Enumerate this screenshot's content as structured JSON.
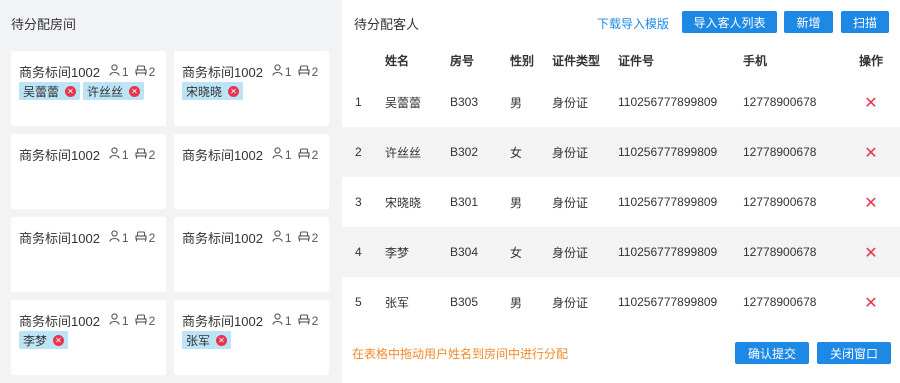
{
  "left": {
    "title": "待分配房间",
    "rooms": [
      {
        "name": "商务标间1002",
        "cap_a": "1",
        "cap_b": "2",
        "guests": [
          "吴蕾蕾",
          "许丝丝"
        ]
      },
      {
        "name": "商务标间1002",
        "cap_a": "1",
        "cap_b": "2",
        "guests": [
          "宋晓晓"
        ]
      },
      {
        "name": "商务标间1002",
        "cap_a": "1",
        "cap_b": "2",
        "guests": []
      },
      {
        "name": "商务标间1002",
        "cap_a": "1",
        "cap_b": "2",
        "guests": []
      },
      {
        "name": "商务标间1002",
        "cap_a": "1",
        "cap_b": "2",
        "guests": []
      },
      {
        "name": "商务标间1002",
        "cap_a": "1",
        "cap_b": "2",
        "guests": []
      },
      {
        "name": "商务标间1002",
        "cap_a": "1",
        "cap_b": "2",
        "guests": [
          "李梦"
        ]
      },
      {
        "name": "商务标间1002",
        "cap_a": "1",
        "cap_b": "2",
        "guests": [
          "张军"
        ]
      }
    ]
  },
  "right": {
    "title": "待分配客人",
    "download_link": "下载导入模版",
    "import_button": "导入客人列表",
    "add_button": "新增",
    "scan_button": "扫描",
    "columns": [
      "",
      "姓名",
      "房号",
      "性别",
      "证件类型",
      "证件号",
      "手机",
      "操作"
    ],
    "rows": [
      {
        "no": "1",
        "name": "吴蕾蕾",
        "room": "B303",
        "gender": "男",
        "id_type": "身份证",
        "id_no": "110256777899809",
        "phone": "12778900678"
      },
      {
        "no": "2",
        "name": "许丝丝",
        "room": "B302",
        "gender": "女",
        "id_type": "身份证",
        "id_no": "110256777899809",
        "phone": "12778900678"
      },
      {
        "no": "3",
        "name": "宋晓晓",
        "room": "B301",
        "gender": "男",
        "id_type": "身份证",
        "id_no": "110256777899809",
        "phone": "12778900678"
      },
      {
        "no": "4",
        "name": "李梦",
        "room": "B304",
        "gender": "女",
        "id_type": "身份证",
        "id_no": "110256777899809",
        "phone": "12778900678"
      },
      {
        "no": "5",
        "name": "张军",
        "room": "B305",
        "gender": "男",
        "id_type": "身份证",
        "id_no": "110256777899809",
        "phone": "12778900678"
      }
    ],
    "delete_glyph": "✕",
    "footer_note": "在表格中拖动用户姓名到房间中进行分配",
    "confirm_button": "确认提交",
    "close_button": "关闭窗口"
  },
  "colors": {
    "accent": "#1e88e5",
    "danger": "#e8344e",
    "tag_bg": "#bde3f7",
    "note": "#ef8a2b"
  },
  "icons": {
    "person": "person-icon",
    "bed": "bed-icon",
    "remove": "remove-circle-icon",
    "delete": "delete-x-icon"
  }
}
